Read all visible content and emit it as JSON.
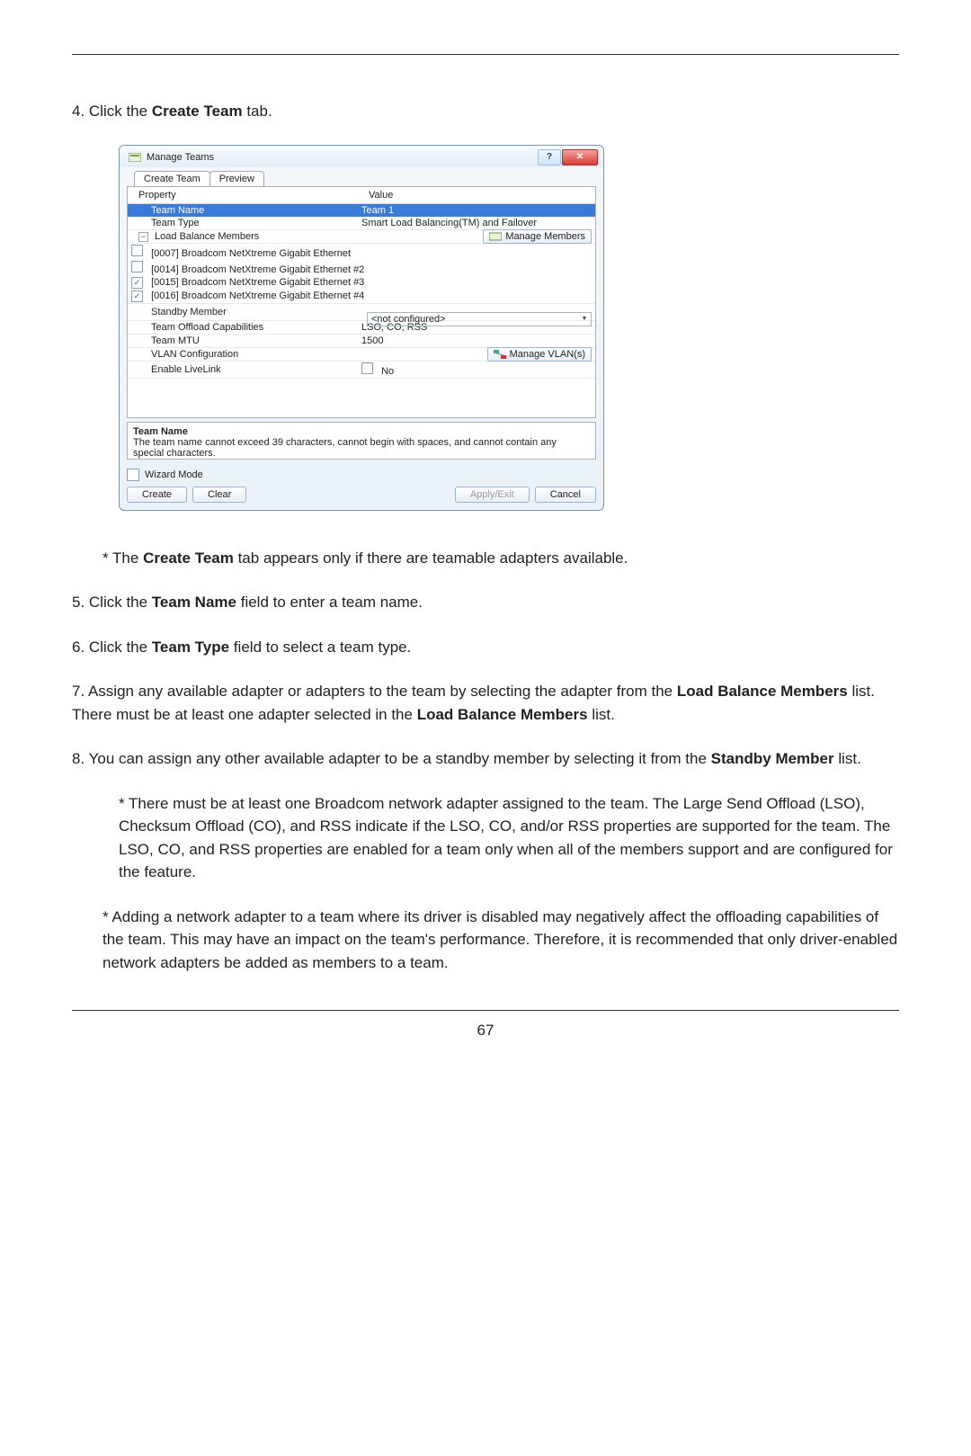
{
  "page_number": "67",
  "steps": {
    "s4_pre": "4. Click the ",
    "s4_b": "Create Team",
    "s4_post": " tab.",
    "s4_note_pre": "* The ",
    "s4_note_b": "Create Team",
    "s4_note_post": " tab appears only if there are teamable adapters available.",
    "s5_pre": "5. Click the ",
    "s5_b": "Team Name",
    "s5_post": " field to enter a team name.",
    "s6_pre": "6. Click the ",
    "s6_b": "Team Type",
    "s6_post": " field to select a team type.",
    "s7_pre": "7. Assign any available adapter or adapters to the team by selecting the adapter from the ",
    "s7_b1": "Load Balance Members",
    "s7_mid": " list. There must be at least one adapter selected in the ",
    "s7_b2": "Load Balance Members",
    "s7_post": " list.",
    "s8_pre": "8. You can assign any other available adapter to be a standby member by selecting it from the ",
    "s8_b": "Standby Member",
    "s8_post": " list.",
    "s8_n1": "* There must be at least one Broadcom network adapter assigned to the team. The Large Send Offload (LSO), Checksum Offload (CO), and RSS indicate if the LSO, CO, and/or RSS properties are supported for the team. The LSO, CO, and RSS properties are enabled for a team only when all of the members support and are configured for the feature.",
    "s8_n2": "* Adding a network adapter to a team where its driver is disabled may negatively affect the offloading capabilities of the team. This may have an impact on the team's performance. Therefore, it is recommended that only driver-enabled network adapters be added as members to a team."
  },
  "dialog": {
    "title": "Manage Teams",
    "tabs": {
      "create": "Create Team",
      "preview": "Preview"
    },
    "cols": {
      "prop": "Property",
      "val": "Value"
    },
    "team_name": {
      "label": "Team Name",
      "value": "Team 1"
    },
    "team_type": {
      "label": "Team Type",
      "value": "Smart Load Balancing(TM) and Failover"
    },
    "lbm": {
      "label": "Load Balance Members",
      "button": "Manage Members"
    },
    "adapters": {
      "a0": "[0007] Broadcom NetXtreme Gigabit Ethernet",
      "a1": "[0014] Broadcom NetXtreme Gigabit Ethernet #2",
      "a2": "[0015] Broadcom NetXtreme Gigabit Ethernet #3",
      "a3": "[0016] Broadcom NetXtreme Gigabit Ethernet #4"
    },
    "standby": {
      "label": "Standby Member",
      "value": "<not configured>"
    },
    "offload": {
      "label": "Team Offload Capabilities",
      "value": "LSO, CO, RSS"
    },
    "mtu": {
      "label": "Team MTU",
      "value": "1500"
    },
    "vlan": {
      "label": "VLAN Configuration",
      "button": "Manage VLAN(s)"
    },
    "livelink": {
      "label": "Enable LiveLink",
      "value": "No"
    },
    "hint_title": "Team Name",
    "hint_body": "The team name cannot exceed 39 characters, cannot begin with spaces, and cannot contain any special characters.",
    "wizard_mode": "Wizard Mode",
    "buttons": {
      "create": "Create",
      "clear": "Clear",
      "apply": "Apply/Exit",
      "cancel": "Cancel"
    }
  }
}
